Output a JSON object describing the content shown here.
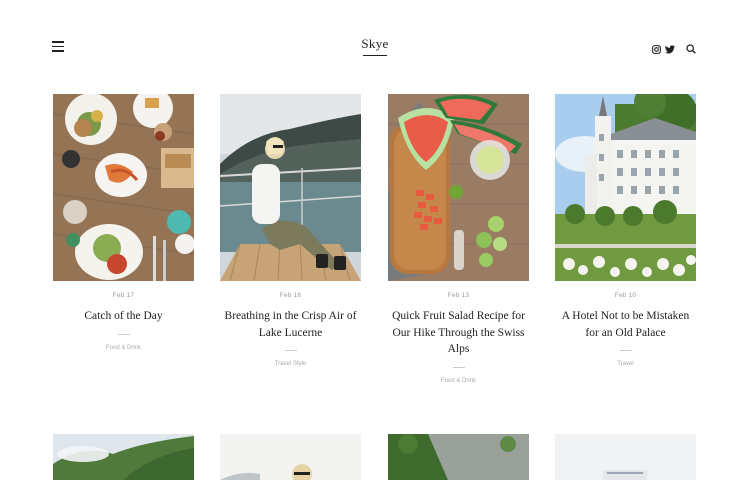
{
  "site": {
    "logo": "Skye"
  },
  "header": {
    "menu_icon": "hamburger-icon",
    "social_icons": [
      "instagram-icon",
      "twitter-icon"
    ],
    "search_icon": "search-icon"
  },
  "posts": [
    {
      "date": "Feb 17",
      "title": "Catch of the Day",
      "category": "Food & Drink"
    },
    {
      "date": "Feb 16",
      "title": "Breathing in the Crisp Air of Lake Lucerne",
      "category": "Travel Style"
    },
    {
      "date": "Feb 13",
      "title": "Quick Fruit Salad Recipe for Our Hike Through the Swiss Alps",
      "category": "Food & Drink"
    },
    {
      "date": "Feb 10",
      "title": "A Hotel Not to be Mistaken for an Old Palace",
      "category": "Travel"
    }
  ]
}
